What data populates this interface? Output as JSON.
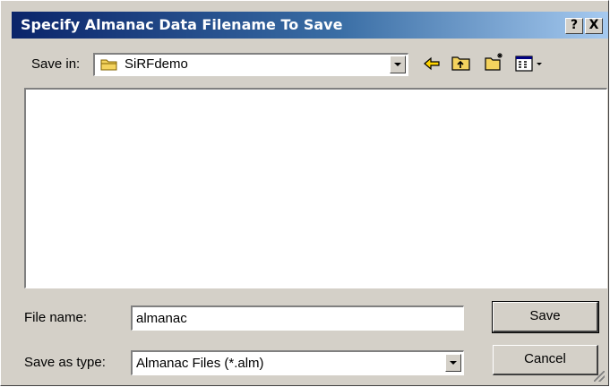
{
  "window": {
    "title": "Specify Almanac Data Filename To Save",
    "help_label": "?",
    "close_label": "X"
  },
  "save_in": {
    "label": "Save in:",
    "folder_icon": "folder-icon",
    "value": "SiRFdemo"
  },
  "toolbar": {
    "back_icon": "back-arrow-icon",
    "up_icon": "up-folder-icon",
    "new_folder_icon": "new-folder-icon",
    "view_menu_icon": "view-menu-icon"
  },
  "file_name": {
    "label": "File name:",
    "value": "almanac"
  },
  "save_as_type": {
    "label": "Save as type:",
    "value": "Almanac Files (*.alm)"
  },
  "buttons": {
    "save": "Save",
    "cancel": "Cancel"
  },
  "colors": {
    "title_start": "#0a246a",
    "title_end": "#a6caf0",
    "face": "#d4d0c8",
    "folder": "#f4d35e"
  }
}
